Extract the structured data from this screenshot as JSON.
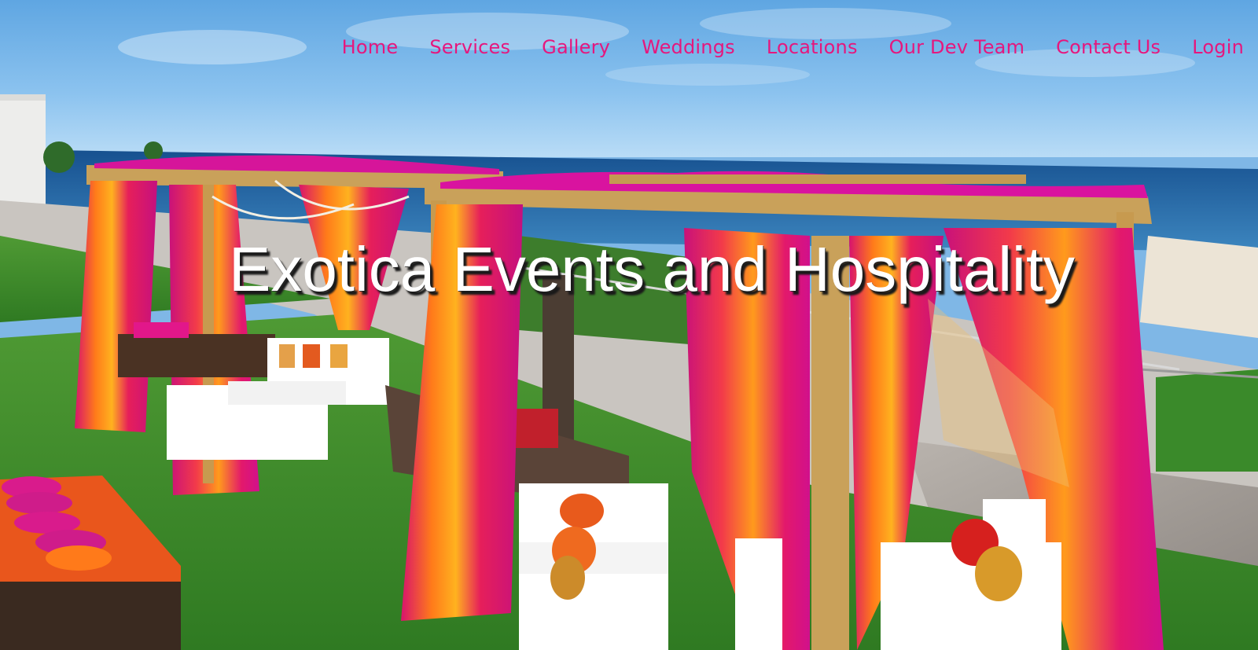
{
  "nav": {
    "items": [
      {
        "label": "Home"
      },
      {
        "label": "Services"
      },
      {
        "label": "Gallery"
      },
      {
        "label": "Weddings"
      },
      {
        "label": "Locations"
      },
      {
        "label": "Our Dev Team"
      },
      {
        "label": "Contact Us"
      },
      {
        "label": "Login"
      }
    ]
  },
  "hero": {
    "title": "Exotica Events and Hospitality"
  },
  "colors": {
    "nav_text": "#e6177d",
    "title_text": "#ffffff",
    "sky": "#7fb7e6",
    "sea": "#1f5fa3",
    "grass": "#3e8a2a",
    "canopy_pink": "#e0189a",
    "curtain_orange": "#ff8c1a",
    "frame_gold": "#c9a15a"
  }
}
